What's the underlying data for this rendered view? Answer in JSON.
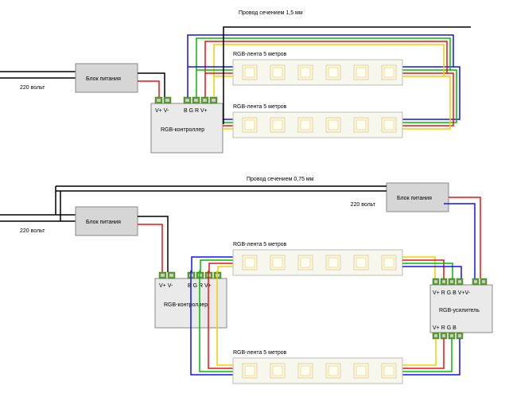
{
  "top": {
    "wire_label": "Провод сечением 1,5 мм",
    "mains": "220 вольт",
    "psu": "Блок питания",
    "controller": {
      "title": "RGB-контроллер",
      "power_pins": "V+ V-",
      "rgb_pins": "B G R V+"
    },
    "strip_a": "RGB-лента 5 метров",
    "strip_b": "RGB-лента 5 метров"
  },
  "bottom": {
    "wire_label": "Провод сечением 0,75 мм",
    "mains_left": "220 вольт",
    "mains_right": "220 вольт",
    "psu_left": "Блок питания",
    "psu_right": "Блок питания",
    "controller": {
      "title": "RGB-контроллер",
      "power_pins": "V+ V-",
      "rgb_pins": "B G R V+"
    },
    "amplifier": {
      "title": "RGB-усилитель",
      "pins_top": "V+ R G B   V+V-",
      "pins_bottom": "V+ R G B"
    },
    "strip_a": "RGB-лента 5 метров",
    "strip_b": "RGB-лента 5 метров"
  }
}
